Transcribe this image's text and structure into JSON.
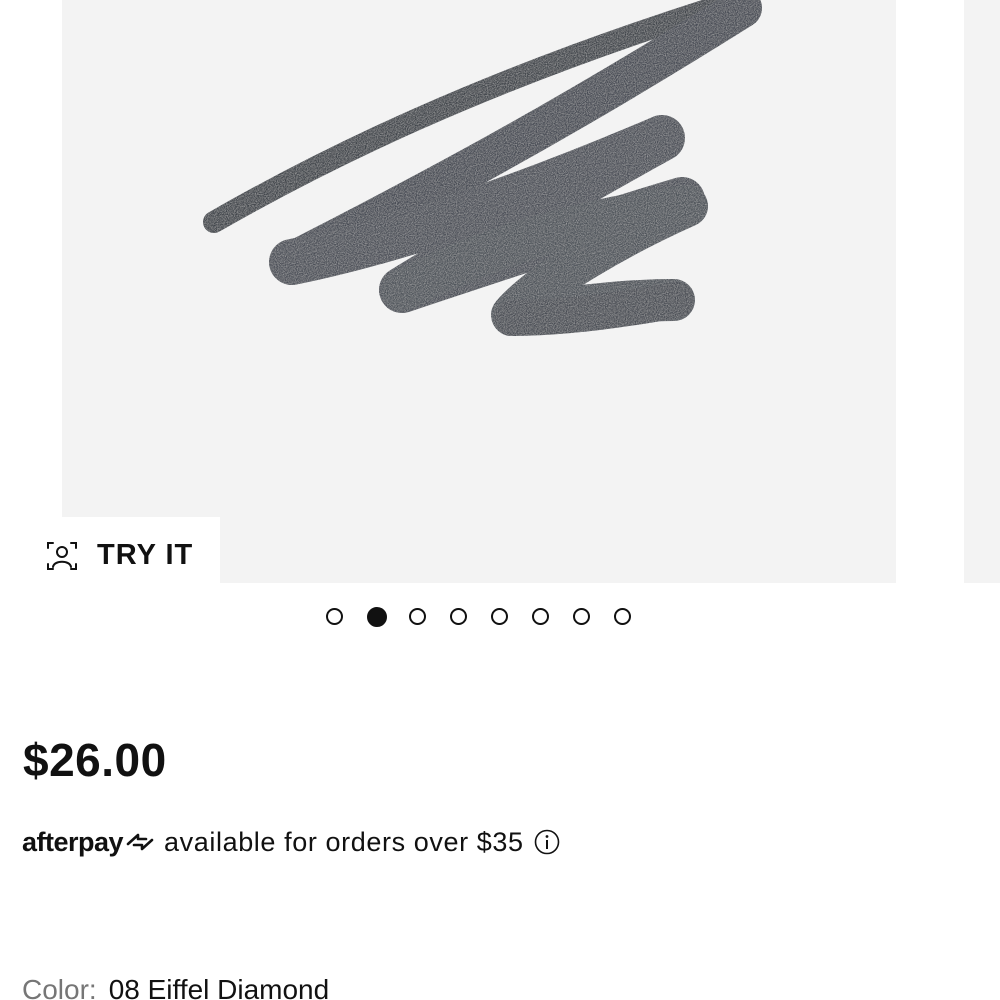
{
  "gallery": {
    "try_it_label": "TRY IT",
    "slide_count": 8,
    "active_slide": 2,
    "swatch_color": "#4a4f57"
  },
  "price": "$26.00",
  "afterpay": {
    "logo_text": "afterpay",
    "message": "available for orders over $35"
  },
  "color": {
    "label": "Color:",
    "value": "08 Eiffel Diamond"
  }
}
